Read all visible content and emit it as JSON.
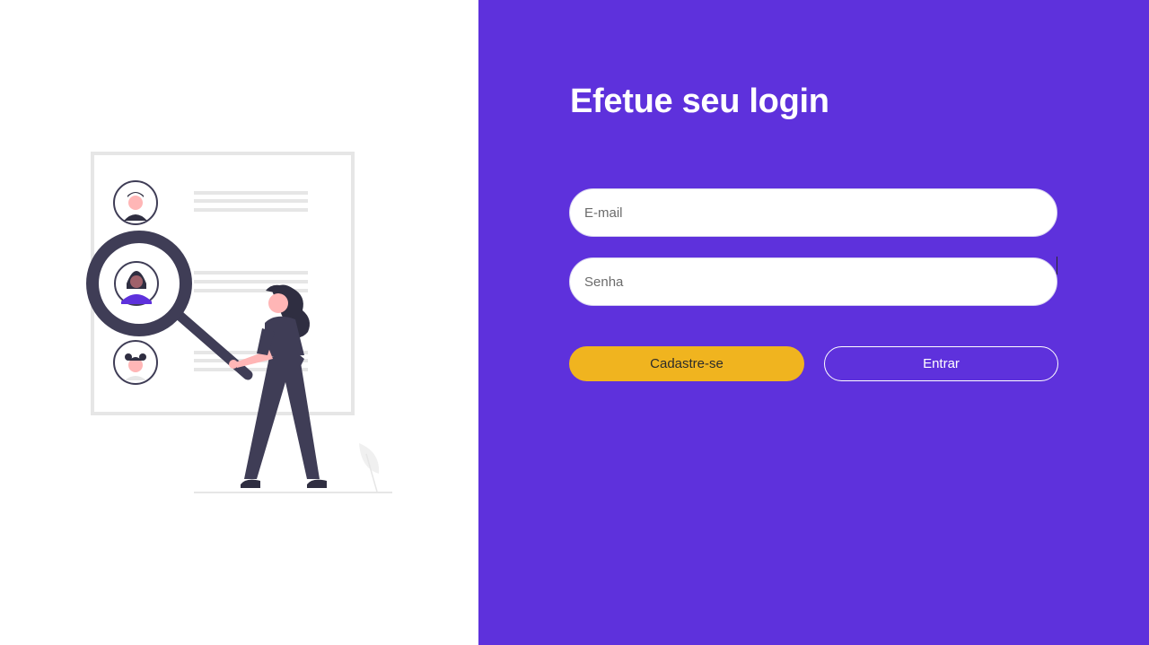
{
  "login": {
    "title": "Efetue seu login",
    "email_placeholder": "E-mail",
    "email_value": "",
    "password_placeholder": "Senha",
    "password_value": "",
    "register_label": "Cadastre-se",
    "submit_label": "Entrar"
  },
  "colors": {
    "accent": "#5e31dc",
    "secondary_button": "#f0b41f",
    "illustration_dark": "#3f3d56",
    "illustration_skin": "#ffb6b6"
  },
  "illustration": {
    "icons": [
      "person-search-illustration",
      "magnifying-glass-icon",
      "avatar-icon",
      "plant-icon"
    ]
  }
}
